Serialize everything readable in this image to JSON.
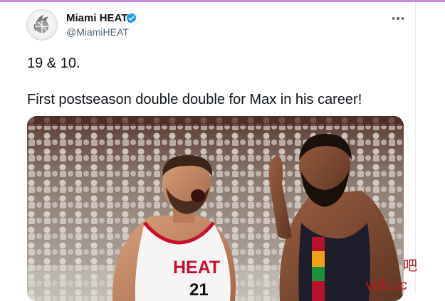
{
  "account": {
    "display_name": "Miami HEAT",
    "handle": "@MiamiHEAT",
    "verified": true,
    "avatar_icon": "heat-logo-icon",
    "verified_color": "#1d9bf0"
  },
  "tweet": {
    "lines": [
      "19 & 10.",
      "First postseason double double for Max in his career!"
    ]
  },
  "media": {
    "jersey": {
      "team_text": "HEAT",
      "number": "21"
    }
  },
  "watermark": {
    "symbol": "吧",
    "url": "vdb.cc"
  },
  "colors": {
    "accent_bar": "#c98be0",
    "heat_red": "#c8102e",
    "text_primary": "#0f1419",
    "text_secondary": "#536471"
  }
}
